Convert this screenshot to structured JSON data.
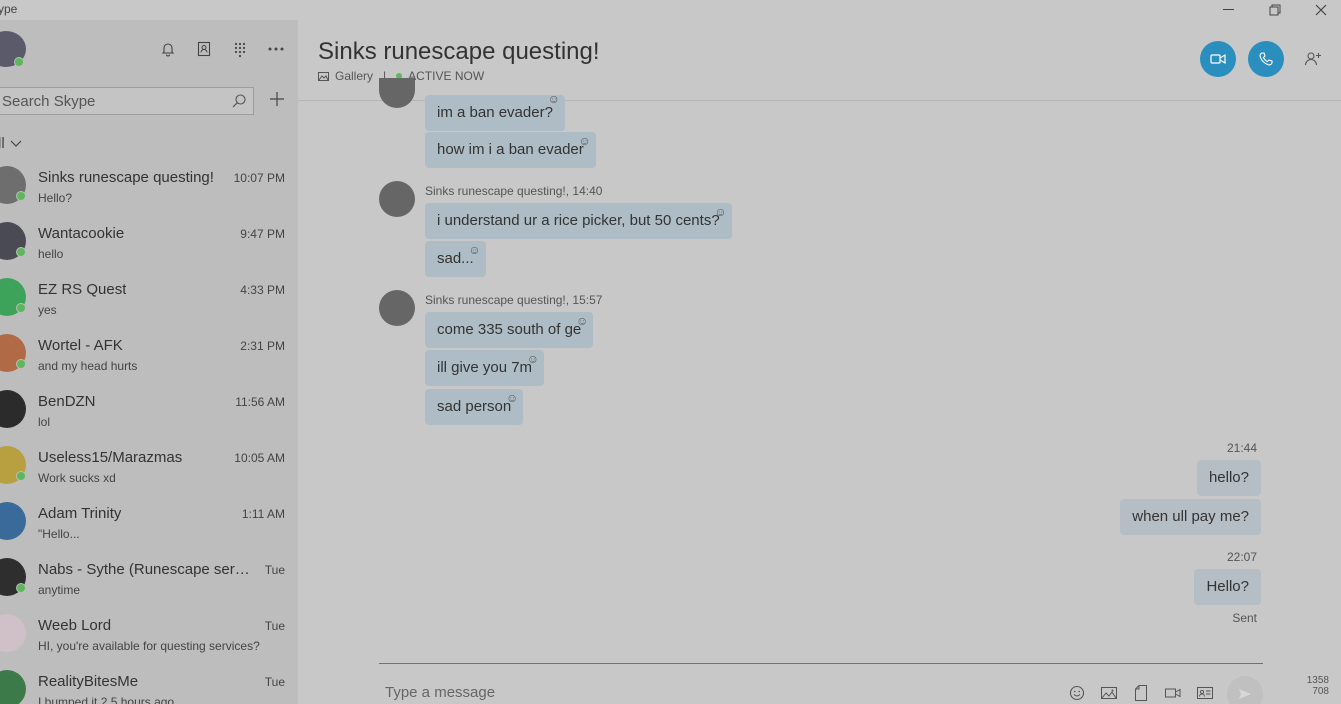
{
  "window": {
    "title": "ype",
    "minimize_glyph": "—",
    "restore_glyph": "❐",
    "close_glyph": "✕"
  },
  "sidebar": {
    "search_placeholder": "Search Skype",
    "filter_label": "ll",
    "chats": [
      {
        "name": "Sinks runescape questing!",
        "time": "10:07 PM",
        "preview": "Hello?",
        "online": true,
        "avatar_color": "#6e6e6e"
      },
      {
        "name": "Wantacookie",
        "time": "9:47 PM",
        "preview": "hello",
        "online": true,
        "avatar_color": "#4a4a55"
      },
      {
        "name": "EZ RS Quest",
        "time": "4:33 PM",
        "preview": "yes",
        "online": true,
        "avatar_color": "#3ea35a"
      },
      {
        "name": "Wortel - AFK",
        "time": "2:31 PM",
        "preview": "and my head hurts",
        "online": true,
        "avatar_color": "#b06a45"
      },
      {
        "name": "BenDZN",
        "time": "11:56 AM",
        "preview": "lol",
        "online": false,
        "avatar_color": "#2b2b2b"
      },
      {
        "name": "Useless15/Marazmas",
        "time": "10:05 AM",
        "preview": "Work sucks xd",
        "online": true,
        "avatar_color": "#b8a040"
      },
      {
        "name": "Adam Trinity",
        "time": "1:11 AM",
        "preview": "\"Hello...",
        "online": false,
        "avatar_color": "#3a6a9a"
      },
      {
        "name": "Nabs - Sythe (Runescape servi...",
        "time": "Tue",
        "preview": "anytime",
        "online": true,
        "avatar_color": "#2e2e2e"
      },
      {
        "name": "Weeb Lord",
        "time": "Tue",
        "preview": "HI, you're available for questing services?",
        "online": false,
        "avatar_color": "#d0c0c8"
      },
      {
        "name": "RealityBitesMe",
        "time": "Tue",
        "preview": "I bumped it 2.5 hours ago",
        "online": false,
        "avatar_color": "#3c7a4a"
      }
    ]
  },
  "header": {
    "title": "Sinks runescape questing!",
    "gallery_label": "Gallery",
    "separator": "|",
    "status": "ACTIVE NOW"
  },
  "messages": {
    "group1": {
      "bubbles": [
        "im a ban evader?",
        "how im i a ban evader"
      ]
    },
    "group2": {
      "meta": "Sinks runescape questing!,  14:40",
      "bubbles": [
        "i understand ur a rice picker, but 50 cents?",
        "sad..."
      ]
    },
    "group3": {
      "meta": "Sinks runescape questing!,  15:57",
      "bubbles": [
        "come 335 south of ge",
        "ill give you 7m",
        "sad person"
      ]
    },
    "mine1": {
      "time": "21:44",
      "bubbles": [
        "hello?",
        "when ull pay me?"
      ]
    },
    "mine2": {
      "time": "22:07",
      "bubbles": [
        "Hello?"
      ],
      "status": "Sent"
    }
  },
  "composer": {
    "placeholder": "Type a message"
  },
  "overlay": {
    "line1": "1358",
    "line2": "708"
  }
}
